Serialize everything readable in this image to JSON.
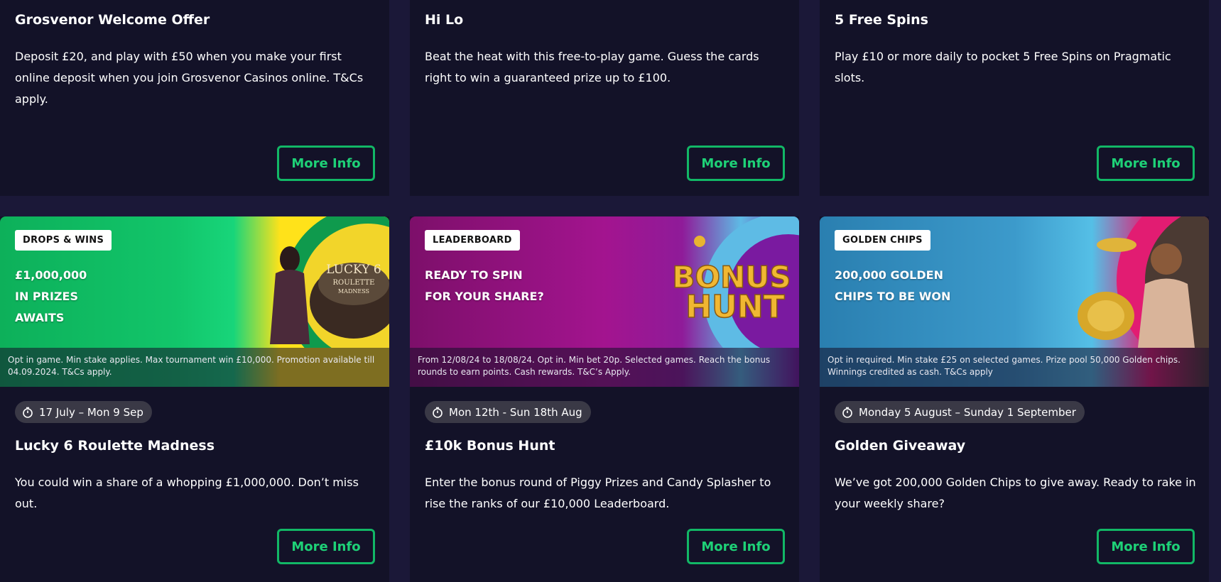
{
  "top_cards": [
    {
      "title": "Grosvenor Welcome Offer",
      "description": "Deposit £20, and play with £50 when you make your first online deposit when you join Grosvenor Casinos online. T&Cs apply.",
      "button_label": "More Info"
    },
    {
      "title": "Hi Lo",
      "description": "Beat the heat with this free-to-play game. Guess the cards right to win a guaranteed prize up to £100.",
      "button_label": "More Info"
    },
    {
      "title": "5 Free Spins",
      "description": "Play £10 or more daily to pocket 5 Free Spins on Pragmatic slots.",
      "button_label": "More Info"
    }
  ],
  "bottom_cards": [
    {
      "banner_tag": "DROPS & WINS",
      "banner_headline_lines": [
        "£1,000,000",
        "IN PRIZES",
        "AWAITS"
      ],
      "banner_art_text_1": "LUCKY 6",
      "banner_art_text_2": "ROULETTE",
      "banner_art_text_3": "MADNESS",
      "banner_terms": "Opt in game. Min stake applies. Max tournament win £10,000. Promotion available till 04.09.2024. T&Cs apply.",
      "date_range": "17 July – Mon 9 Sep",
      "title": "Lucky 6 Roulette Madness",
      "description": "You could win a share of a whopping £1,000,000. Don’t miss out.",
      "button_label": "More Info"
    },
    {
      "banner_tag": "LEADERBOARD",
      "banner_headline_lines": [
        "READY TO SPIN",
        "FOR YOUR SHARE?"
      ],
      "banner_art_text_1": "BONUS",
      "banner_art_text_2": "HUNT",
      "banner_terms": "From 12/08/24 to 18/08/24. Opt in. Min bet 20p.  Selected games. Reach the bonus rounds to earn points. Cash rewards. T&C’s Apply.",
      "date_range": "Mon 12th - Sun 18th Aug",
      "title": "£10k Bonus Hunt",
      "description": "Enter the bonus round of Piggy Prizes and Candy Splasher to rise the ranks of our £10,000 Leaderboard.",
      "button_label": "More Info"
    },
    {
      "banner_tag": "GOLDEN CHIPS",
      "banner_headline_lines": [
        "200,000 GOLDEN",
        "CHIPS TO BE WON"
      ],
      "banner_terms": "Opt in required. Min stake £25 on selected games. Prize pool 50,000 Golden chips. Winnings credited as cash. T&Cs apply",
      "date_range": "Monday 5 August – Sunday 1 September",
      "title": "Golden Giveaway",
      "description": "We’ve got 200,000 Golden Chips to give away. Ready to rake in your weekly share?",
      "button_label": "More Info"
    }
  ],
  "colors": {
    "page_bg": "#1b1838",
    "card_bg": "#131228",
    "accent_green": "#1ed177",
    "pill_bg": "#3a3946"
  }
}
